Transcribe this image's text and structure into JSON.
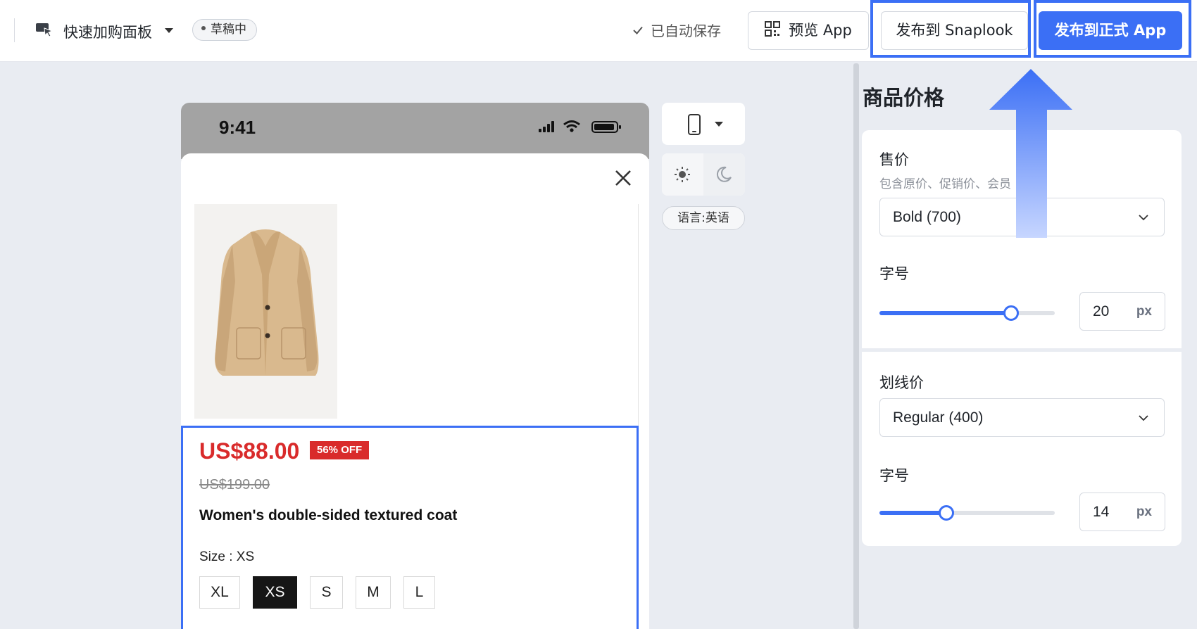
{
  "topbar": {
    "page_title": "快速加购面板",
    "draft_badge": "草稿中",
    "autosave": "已自动保存",
    "preview_button": "预览 App",
    "publish_snaplook_button": "发布到 Snaplook",
    "publish_app_button": "发布到正式 App"
  },
  "phone": {
    "status_time": "9:41",
    "product": {
      "price": "US$88.00",
      "discount_badge": "56% OFF",
      "original_price": "US$199.00",
      "name": "Women's double-sided textured coat",
      "size_label": "Size : XS",
      "sizes": [
        "XL",
        "XS",
        "S",
        "M",
        "L"
      ],
      "selected_size": "XS"
    }
  },
  "tools": {
    "language_pill": "语言:英语"
  },
  "panel": {
    "title": "商品价格",
    "sale_price": {
      "label": "售价",
      "hint": "包含原价、促销价、会员",
      "font_weight": "Bold (700)",
      "size_label": "字号",
      "size_value": "20",
      "size_unit": "px",
      "slider_level": 0.75
    },
    "strike_price": {
      "label": "划线价",
      "font_weight": "Regular (400)",
      "size_label": "字号",
      "size_value": "14",
      "size_unit": "px",
      "slider_level": 0.38
    }
  },
  "colors": {
    "accent": "#3b6ff5",
    "price_red": "#d92b2b",
    "background": "#e9ecf2"
  }
}
